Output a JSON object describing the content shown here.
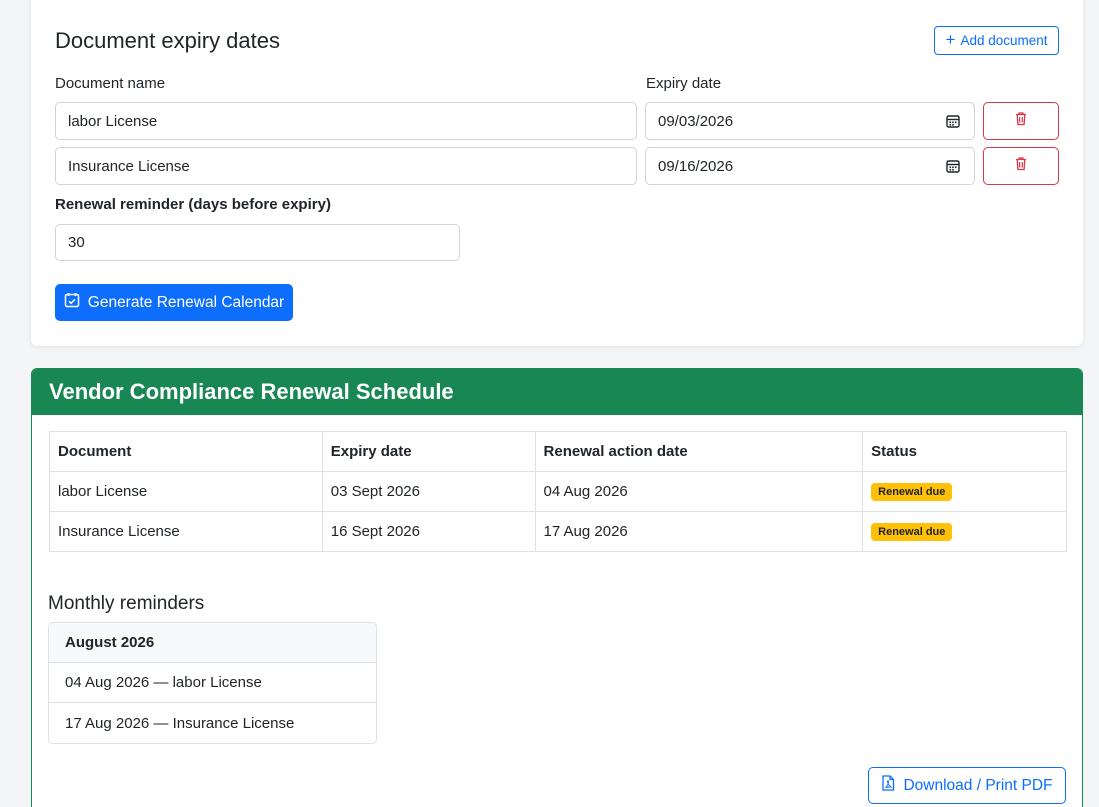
{
  "form": {
    "title": "Document expiry dates",
    "add_button": "Add document",
    "name_label": "Document name",
    "date_label": "Expiry date",
    "rows": [
      {
        "name": "labor License",
        "date": "09/03/2026"
      },
      {
        "name": "Insurance License",
        "date": "09/16/2026"
      }
    ],
    "reminder_label": "Renewal reminder (days before expiry)",
    "reminder_value": "30",
    "generate_button": "Generate Renewal Calendar"
  },
  "schedule": {
    "title": "Vendor Compliance Renewal Schedule",
    "columns": [
      "Document",
      "Expiry date",
      "Renewal action date",
      "Status"
    ],
    "rows": [
      {
        "document": "labor License",
        "expiry": "03 Sept 2026",
        "action": "04 Aug 2026",
        "status": "Renewal due"
      },
      {
        "document": "Insurance License",
        "expiry": "16 Sept 2026",
        "action": "17 Aug 2026",
        "status": "Renewal due"
      }
    ],
    "monthly_title": "Monthly reminders",
    "month": "August 2026",
    "reminders": [
      "04 Aug 2026 — labor License",
      "17 Aug 2026 — Insurance License"
    ],
    "pdf_button": "Download / Print PDF"
  },
  "colors": {
    "primary": "#0d6efd",
    "success": "#198754",
    "danger": "#dc3545",
    "warning": "#ffc107"
  },
  "icons": {
    "add": "plus-icon",
    "calendar": "calendar-icon",
    "delete": "trash-icon",
    "generate": "calendar-check-icon",
    "pdf": "file-pdf-icon"
  }
}
